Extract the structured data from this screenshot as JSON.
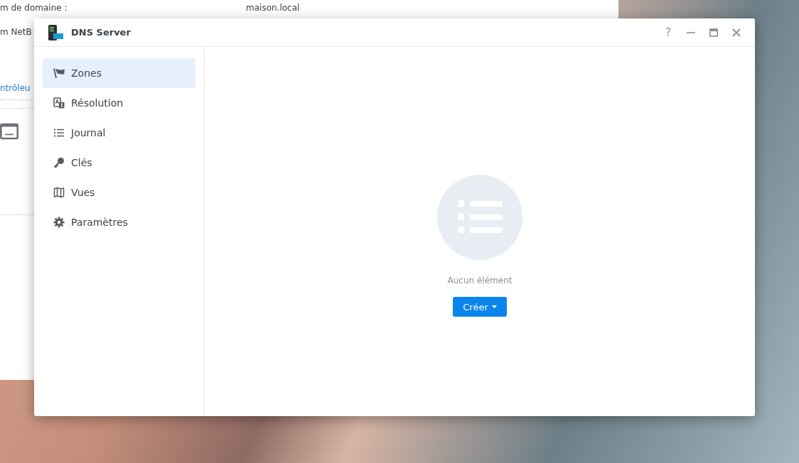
{
  "background_window": {
    "fields": [
      {
        "label": "m de domaine :",
        "value": "maison.local"
      },
      {
        "label": "m NetB"
      }
    ],
    "link": "ntrôleu"
  },
  "window": {
    "title": "DNS Server",
    "controls": [
      {
        "kind": "help",
        "label": "?"
      },
      {
        "kind": "minimize"
      },
      {
        "kind": "maximize"
      },
      {
        "kind": "close"
      }
    ]
  },
  "sidebar": {
    "items": [
      {
        "kind": "flag",
        "label": "Zones",
        "selected": true
      },
      {
        "kind": "resolution",
        "label": "Résolution",
        "selected": false
      },
      {
        "kind": "list",
        "label": "Journal",
        "selected": false
      },
      {
        "kind": "key",
        "label": "Clés",
        "selected": false
      },
      {
        "kind": "map",
        "label": "Vues",
        "selected": false
      },
      {
        "kind": "gear",
        "label": "Paramètres",
        "selected": false
      }
    ]
  },
  "empty_state": {
    "message": "Aucun élément",
    "button": "Créer"
  }
}
